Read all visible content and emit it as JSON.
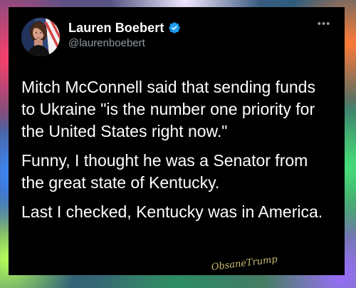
{
  "user": {
    "display_name": "Lauren Boebert",
    "handle": "@laurenboebert"
  },
  "icons": {
    "avatar": "profile-photo",
    "verified": "verified-badge-icon",
    "more": "more-options-icon"
  },
  "tweet": {
    "paragraphs": [
      "Mitch McConnell said that sending funds to Ukraine \"is the number one priority for the United States right now.\"",
      "Funny, I thought he was a Senator from the great state of Kentucky.",
      "Last I checked, Kentucky was in America."
    ]
  },
  "watermark": {
    "text": "ObsaneTrump"
  },
  "colors": {
    "card_background": "#000000",
    "verified_blue": "#1d9bf0",
    "secondary_text": "#8f9aa3",
    "primary_text": "#ffffff"
  }
}
